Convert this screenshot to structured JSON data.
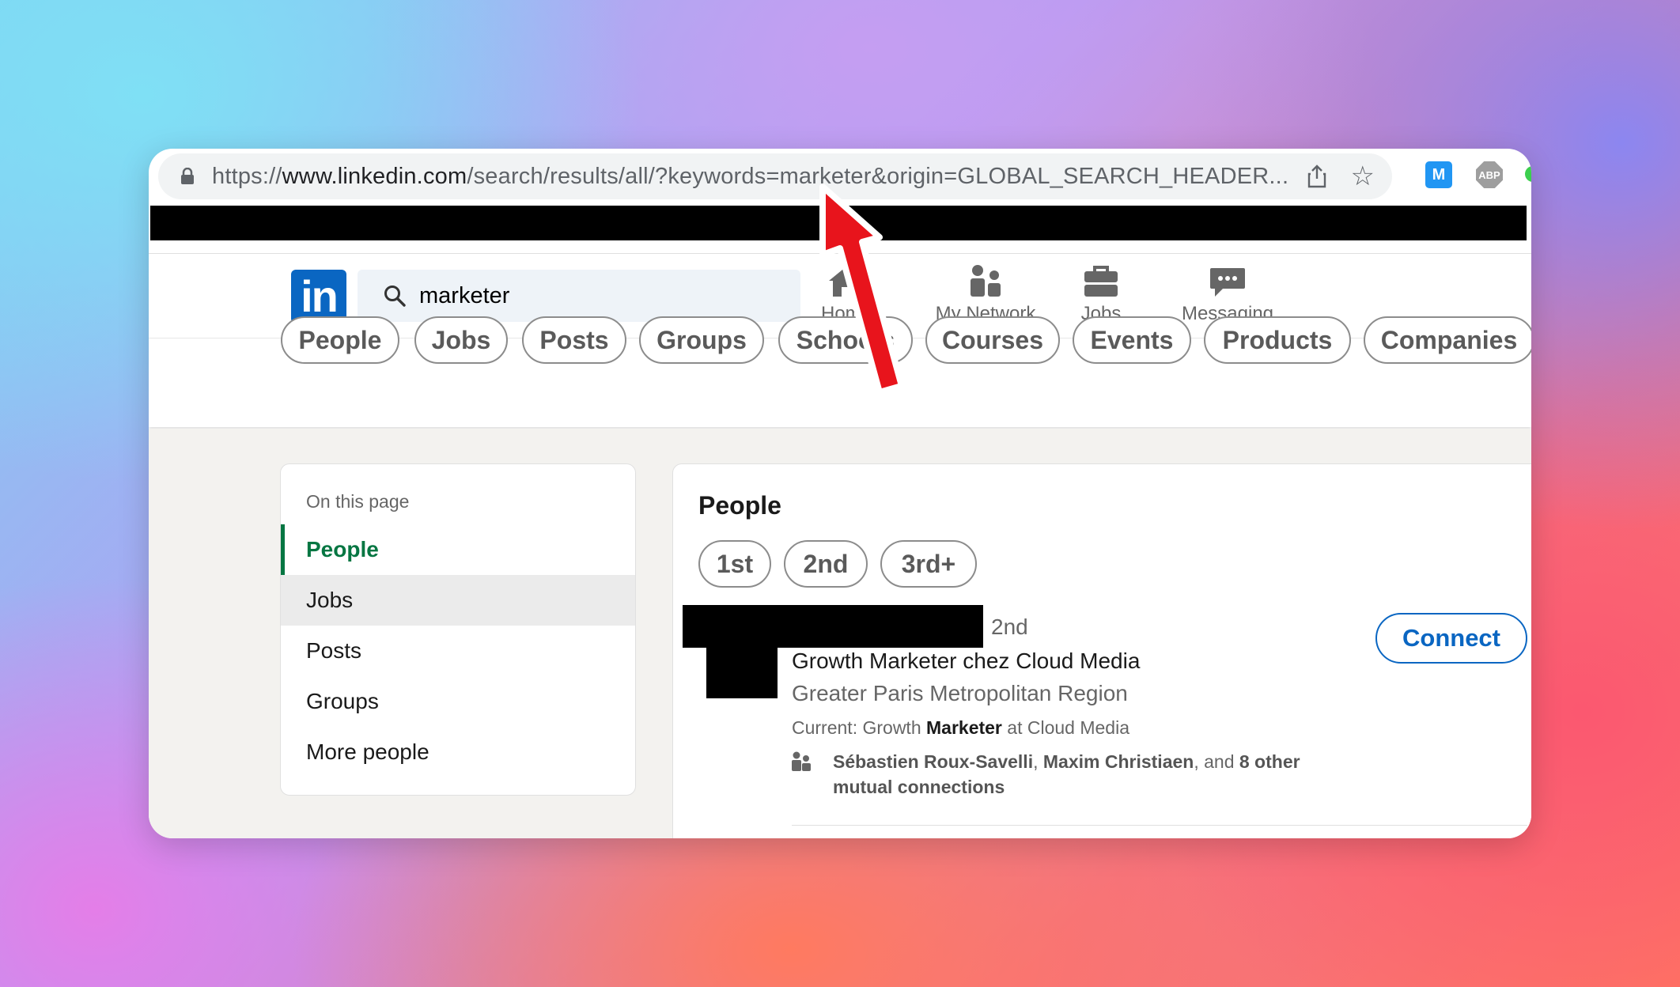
{
  "browser": {
    "url_prefix": "https://",
    "url_host": "www.linkedin.com",
    "url_path": "/search/results/all/?keywords=marketer&origin=GLOBAL_SEARCH_HEADER...",
    "icons": {
      "lock": "lock-icon",
      "share": "share-icon",
      "star": "bookmark-star-icon"
    },
    "extensions": [
      {
        "name": "extension-icon-1",
        "label": "M"
      },
      {
        "name": "adblock-extension-icon",
        "label": "ABP"
      }
    ]
  },
  "header": {
    "logo": "in",
    "search_value": "marketer",
    "nav": [
      {
        "label": "Home",
        "icon": "home-icon"
      },
      {
        "label": "My Network",
        "icon": "network-icon"
      },
      {
        "label": "Jobs",
        "icon": "briefcase-icon"
      },
      {
        "label": "Messaging",
        "icon": "messaging-icon"
      }
    ]
  },
  "filters": [
    "People",
    "Jobs",
    "Posts",
    "Groups",
    "Schools",
    "Courses",
    "Events",
    "Products",
    "Companies"
  ],
  "sidebar": {
    "heading": "On this page",
    "items": [
      {
        "label": "People",
        "state": "active"
      },
      {
        "label": "Jobs",
        "state": "hover"
      },
      {
        "label": "Posts",
        "state": "normal"
      },
      {
        "label": "Groups",
        "state": "normal"
      },
      {
        "label": "More people",
        "state": "normal"
      }
    ]
  },
  "people_section": {
    "title": "People",
    "connection_filters": [
      "1st",
      "2nd",
      "3rd+"
    ],
    "result": {
      "degree": "2nd",
      "headline": "Growth Marketer chez Cloud Media",
      "location": "Greater Paris Metropolitan Region",
      "current_prefix": "Current: Growth ",
      "current_highlight": "Marketer",
      "current_suffix": " at Cloud Media",
      "mutual_name1": "Sébastien Roux-Savelli",
      "mutual_sep": ", ",
      "mutual_name2": "Maxim Christiaen",
      "mutual_and": ", and ",
      "mutual_other": "8 other mutual connections",
      "connect_label": "Connect"
    }
  },
  "colors": {
    "brand_blue": "#0a66c2",
    "active_green": "#057642",
    "annotation_arrow": "#e8141c"
  }
}
